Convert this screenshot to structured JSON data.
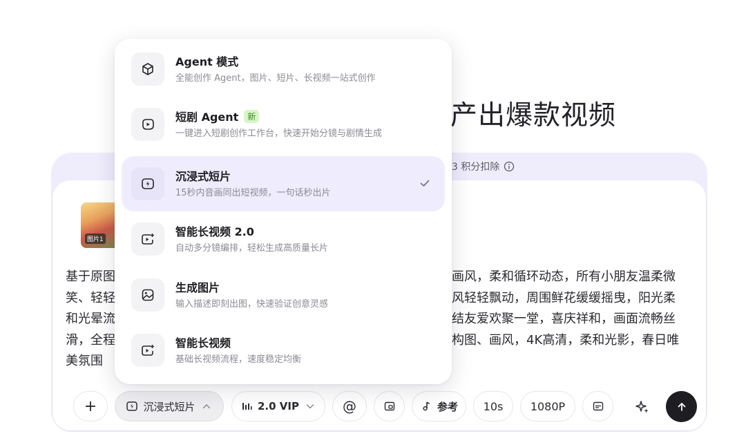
{
  "headline": "产出爆款视频",
  "credits_text": "3 积分扣除",
  "thumbnail": {
    "label": "图片1"
  },
  "prompt": "基于原图\n笑、轻轻\n和光晕流\n滑，全程\n美氛围",
  "prompt_right": "画风，柔和循环动态，所有小朋友温柔微\n风轻轻飘动，周围鲜花缓缓摇曳，阳光柔\n结友爱欢聚一堂，喜庆祥和，画面流畅丝\n构图、画风，4K高清，柔和光影，春日唯",
  "menu": {
    "items": [
      {
        "title": "Agent 模式",
        "desc": "全能创作 Agent，图片、短片、长视频一站式创作",
        "icon": "cube-icon",
        "badge": ""
      },
      {
        "title": "短剧 Agent",
        "desc": "一键进入短剧创作工作台，快速开始分镜与剧情生成",
        "icon": "drama-icon",
        "badge": "新"
      },
      {
        "title": "沉浸式短片",
        "desc": "15秒内音画同出短视频，一句话秒出片",
        "icon": "bolt-icon",
        "badge": "",
        "selected": true
      },
      {
        "title": "智能长视频 2.0",
        "desc": "自动多分镜编排，轻松生成高质量长片",
        "icon": "video-plus-icon",
        "badge": ""
      },
      {
        "title": "生成图片",
        "desc": "输入描述即刻出图，快速验证创意灵感",
        "icon": "image-icon",
        "badge": ""
      },
      {
        "title": "智能长视频",
        "desc": "基础长视频流程，速度稳定均衡",
        "icon": "video-plus-icon",
        "badge": ""
      }
    ]
  },
  "toolbar": {
    "add": "+",
    "mode": "沉浸式短片",
    "model": "2.0 VIP",
    "mention": "@",
    "reference": "参考",
    "duration": "10s",
    "resolution": "1080P"
  }
}
